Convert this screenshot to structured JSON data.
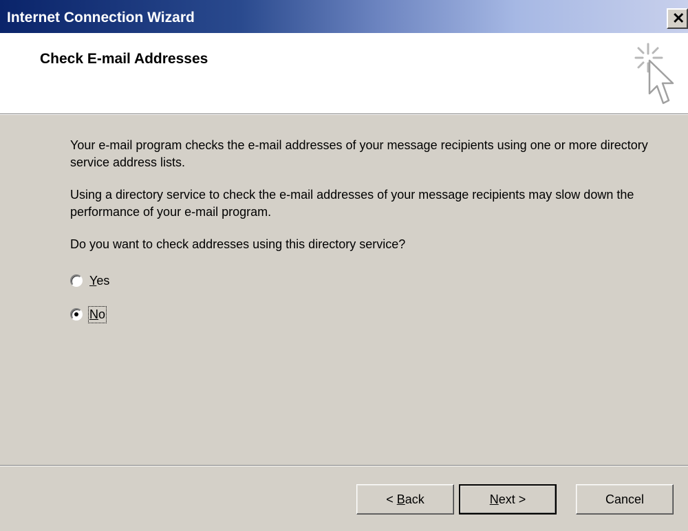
{
  "window": {
    "title": "Internet Connection Wizard",
    "close_label": "×"
  },
  "header": {
    "title": "Check E-mail Addresses",
    "icon": "wizard-cursor-sparkle"
  },
  "content": {
    "paragraph1": "Your e-mail program checks the e-mail addresses of your message recipients using one or more directory service address lists.",
    "paragraph2": "Using a directory service to check the e-mail addresses of your message recipients may slow down the performance of your e-mail program.",
    "question": "Do you want to check addresses using this directory service?",
    "options": [
      {
        "label_prefix": "",
        "mnemonic": "Y",
        "label_rest": "es",
        "selected": false
      },
      {
        "label_prefix": "",
        "mnemonic": "N",
        "label_rest": "o",
        "selected": true
      }
    ]
  },
  "buttons": {
    "back": {
      "prefix": "< ",
      "mnemonic": "B",
      "rest": "ack"
    },
    "next": {
      "prefix": "",
      "mnemonic": "N",
      "rest": "ext >"
    },
    "cancel": "Cancel"
  },
  "colors": {
    "title_start": "#0a246a",
    "title_end": "#c8d0ec",
    "face": "#d4d0c8"
  }
}
